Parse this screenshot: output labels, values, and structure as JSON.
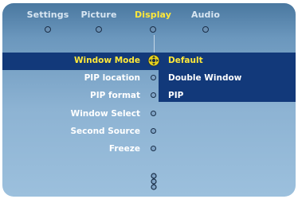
{
  "tabs": [
    {
      "label": "Settings"
    },
    {
      "label": "Picture"
    },
    {
      "label": "Display",
      "active": true
    },
    {
      "label": "Audio"
    }
  ],
  "menu": {
    "items": [
      {
        "label": "Window Mode",
        "active": true
      },
      {
        "label": "PIP location"
      },
      {
        "label": "PIP format"
      },
      {
        "label": "Window Select"
      },
      {
        "label": "Second Source"
      },
      {
        "label": "Freeze"
      }
    ]
  },
  "submenu": {
    "options": [
      {
        "label": "Default",
        "selected": true
      },
      {
        "label": "Double Window"
      },
      {
        "label": "PIP"
      }
    ]
  },
  "colors": {
    "accent": "#ffe83a",
    "highlight": "#12397a",
    "background_top": "#4a78a0",
    "background_bottom": "#9cc0dd"
  },
  "icons": {
    "cursor": "navigation-cursor-icon",
    "scroll": "scroll-indicator-icon"
  }
}
